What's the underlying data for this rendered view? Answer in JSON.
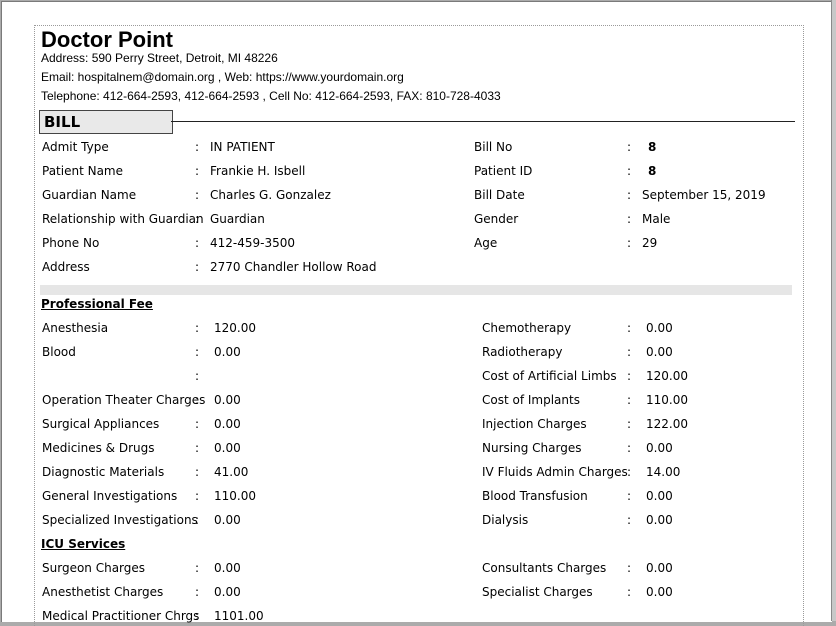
{
  "hospital": {
    "name": "Doctor Point",
    "address": "Address: 590 Perry Street, Detroit, MI 48226",
    "email_web": "Email: hospitalnem@domain.org , Web: https://www.yourdomain.org",
    "phones": "Telephone: 412-664-2593, 412-664-2593  ,  Cell No: 412-664-2593, FAX: 810-728-4033"
  },
  "bill_title": "BILL",
  "separator": ":",
  "patient_info": {
    "left": [
      {
        "label": "Admit Type",
        "value": "IN PATIENT"
      },
      {
        "label": "Patient Name",
        "value": "Frankie H. Isbell"
      },
      {
        "label": "Guardian Name",
        "value": "Charles G. Gonzalez"
      },
      {
        "label": "Relationship with Guardian",
        "value": "Guardian"
      },
      {
        "label": "Phone No",
        "value": "412-459-3500"
      },
      {
        "label": "Address",
        "value": "2770 Chandler Hollow Road"
      }
    ],
    "right": [
      {
        "label": "Bill No",
        "value": "8"
      },
      {
        "label": "Patient ID",
        "value": "8"
      },
      {
        "label": "Bill Date",
        "value": "September 15, 2019"
      },
      {
        "label": "Gender",
        "value": "Male"
      },
      {
        "label": "Age",
        "value": "29"
      }
    ]
  },
  "professional_fee": {
    "title": "Professional Fee",
    "left": [
      {
        "label": "Anesthesia",
        "value": "120.00"
      },
      {
        "label": "Blood",
        "value": "0.00"
      },
      {
        "label": "",
        "value": ""
      },
      {
        "label": "Operation Theater Charges",
        "value": "0.00"
      },
      {
        "label": "Surgical Appliances",
        "value": "0.00"
      },
      {
        "label": "Medicines & Drugs",
        "value": "0.00"
      },
      {
        "label": "Diagnostic Materials",
        "value": "41.00"
      },
      {
        "label": "General Investigations",
        "value": "110.00"
      },
      {
        "label": "Specialized Investigations",
        "value": "0.00"
      }
    ],
    "right": [
      {
        "label": "Chemotherapy",
        "value": "0.00"
      },
      {
        "label": "Radiotherapy",
        "value": "0.00"
      },
      {
        "label": "Cost of Artificial Limbs",
        "value": "120.00"
      },
      {
        "label": "Cost of Implants",
        "value": "110.00"
      },
      {
        "label": "Injection Charges",
        "value": "122.00"
      },
      {
        "label": "Nursing Charges",
        "value": "0.00"
      },
      {
        "label": "IV Fluids Admin Charges",
        "value": "14.00"
      },
      {
        "label": "Blood Transfusion",
        "value": "0.00"
      },
      {
        "label": "Dialysis",
        "value": "0.00"
      }
    ]
  },
  "icu_services": {
    "title": "ICU Services",
    "left": [
      {
        "label": "Surgeon Charges",
        "value": "0.00"
      },
      {
        "label": "Anesthetist Charges",
        "value": "0.00"
      },
      {
        "label": "Medical Practitioner Chrgs",
        "value": "1101.00"
      }
    ],
    "right": [
      {
        "label": "Consultants Charges",
        "value": "0.00"
      },
      {
        "label": "Specialist Charges",
        "value": "0.00"
      }
    ]
  }
}
